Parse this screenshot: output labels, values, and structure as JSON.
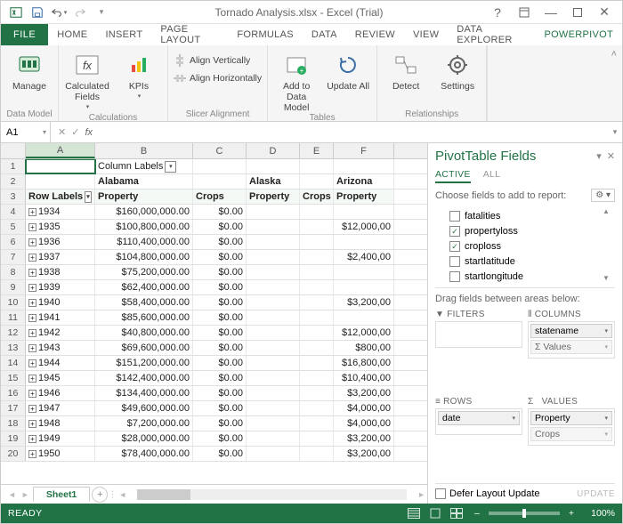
{
  "title": "Tornado Analysis.xlsx - Excel (Trial)",
  "ribbon_tabs": [
    "FILE",
    "HOME",
    "INSERT",
    "PAGE LAYOUT",
    "FORMULAS",
    "DATA",
    "REVIEW",
    "VIEW",
    "DATA EXPLORER",
    "POWERPIVOT"
  ],
  "ribbon": {
    "manage": "Manage",
    "calc_fields": "Calculated Fields",
    "kpis": "KPIs",
    "align_v": "Align Vertically",
    "align_h": "Align Horizontally",
    "add_model": "Add to Data Model",
    "update_all": "Update All",
    "detect": "Detect",
    "settings": "Settings",
    "g_model": "Data Model",
    "g_calc": "Calculations",
    "g_slicer": "Slicer Alignment",
    "g_tables": "Tables",
    "g_rel": "Relationships"
  },
  "name_box": "A1",
  "columns": [
    "A",
    "B",
    "C",
    "D",
    "E",
    "F"
  ],
  "row1": {
    "b": "Column Labels"
  },
  "row2": {
    "b": "Alabama",
    "d": "Alaska",
    "f": "Arizona"
  },
  "row3": {
    "a": "Row Labels",
    "b": "Property",
    "c": "Crops",
    "d": "Property",
    "e": "Crops",
    "f": "Property"
  },
  "data_rows": [
    {
      "n": 4,
      "y": "1934",
      "b": "$160,000,000.00",
      "c": "$0.00",
      "f": ""
    },
    {
      "n": 5,
      "y": "1935",
      "b": "$100,800,000.00",
      "c": "$0.00",
      "f": "$12,000,00"
    },
    {
      "n": 6,
      "y": "1936",
      "b": "$110,400,000.00",
      "c": "$0.00",
      "f": ""
    },
    {
      "n": 7,
      "y": "1937",
      "b": "$104,800,000.00",
      "c": "$0.00",
      "f": "$2,400,00"
    },
    {
      "n": 8,
      "y": "1938",
      "b": "$75,200,000.00",
      "c": "$0.00",
      "f": ""
    },
    {
      "n": 9,
      "y": "1939",
      "b": "$62,400,000.00",
      "c": "$0.00",
      "f": ""
    },
    {
      "n": 10,
      "y": "1940",
      "b": "$58,400,000.00",
      "c": "$0.00",
      "f": "$3,200,00"
    },
    {
      "n": 11,
      "y": "1941",
      "b": "$85,600,000.00",
      "c": "$0.00",
      "f": ""
    },
    {
      "n": 12,
      "y": "1942",
      "b": "$40,800,000.00",
      "c": "$0.00",
      "f": "$12,000,00"
    },
    {
      "n": 13,
      "y": "1943",
      "b": "$69,600,000.00",
      "c": "$0.00",
      "f": "$800,00"
    },
    {
      "n": 14,
      "y": "1944",
      "b": "$151,200,000.00",
      "c": "$0.00",
      "f": "$16,800,00"
    },
    {
      "n": 15,
      "y": "1945",
      "b": "$142,400,000.00",
      "c": "$0.00",
      "f": "$10,400,00"
    },
    {
      "n": 16,
      "y": "1946",
      "b": "$134,400,000.00",
      "c": "$0.00",
      "f": "$3,200,00"
    },
    {
      "n": 17,
      "y": "1947",
      "b": "$49,600,000.00",
      "c": "$0.00",
      "f": "$4,000,00"
    },
    {
      "n": 18,
      "y": "1948",
      "b": "$7,200,000.00",
      "c": "$0.00",
      "f": "$4,000,00"
    },
    {
      "n": 19,
      "y": "1949",
      "b": "$28,000,000.00",
      "c": "$0.00",
      "f": "$3,200,00"
    },
    {
      "n": 20,
      "y": "1950",
      "b": "$78,400,000.00",
      "c": "$0.00",
      "f": "$3,200,00"
    }
  ],
  "sheet": "Sheet1",
  "task_pane": {
    "title": "PivotTable Fields",
    "tab_active": "ACTIVE",
    "tab_all": "ALL",
    "choose": "Choose fields to add to report:",
    "fields": [
      {
        "label": "fatalities",
        "checked": false
      },
      {
        "label": "propertyloss",
        "checked": true
      },
      {
        "label": "croploss",
        "checked": true
      },
      {
        "label": "startlatitude",
        "checked": false
      },
      {
        "label": "startlongitude",
        "checked": false
      }
    ],
    "drag": "Drag fields between areas below:",
    "filters": "FILTERS",
    "columns": "COLUMNS",
    "rows": "ROWS",
    "values": "VALUES",
    "col_pill": "statename",
    "row_pill": "date",
    "val_pill1": "Property",
    "val_pill2": "Crops",
    "val_pill_extra": "Σ  Values",
    "defer": "Defer Layout Update",
    "update": "UPDATE",
    "sigma": "Σ"
  },
  "status": {
    "ready": "READY",
    "zoom": "100%"
  }
}
